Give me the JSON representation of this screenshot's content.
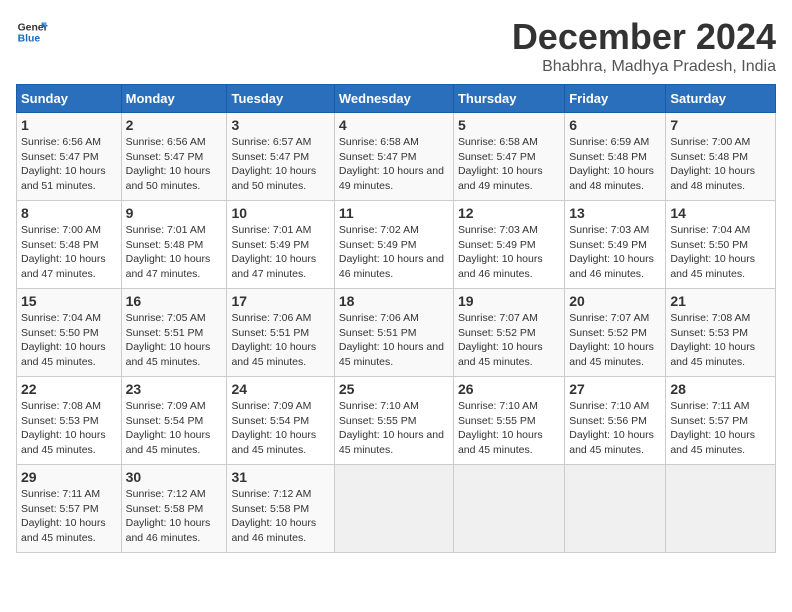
{
  "logo": {
    "line1": "General",
    "line2": "Blue"
  },
  "title": "December 2024",
  "subtitle": "Bhabhra, Madhya Pradesh, India",
  "weekdays": [
    "Sunday",
    "Monday",
    "Tuesday",
    "Wednesday",
    "Thursday",
    "Friday",
    "Saturday"
  ],
  "weeks": [
    [
      {
        "day": "1",
        "sunrise": "6:56 AM",
        "sunset": "5:47 PM",
        "daylight": "10 hours and 51 minutes."
      },
      {
        "day": "2",
        "sunrise": "6:56 AM",
        "sunset": "5:47 PM",
        "daylight": "10 hours and 50 minutes."
      },
      {
        "day": "3",
        "sunrise": "6:57 AM",
        "sunset": "5:47 PM",
        "daylight": "10 hours and 50 minutes."
      },
      {
        "day": "4",
        "sunrise": "6:58 AM",
        "sunset": "5:47 PM",
        "daylight": "10 hours and 49 minutes."
      },
      {
        "day": "5",
        "sunrise": "6:58 AM",
        "sunset": "5:47 PM",
        "daylight": "10 hours and 49 minutes."
      },
      {
        "day": "6",
        "sunrise": "6:59 AM",
        "sunset": "5:48 PM",
        "daylight": "10 hours and 48 minutes."
      },
      {
        "day": "7",
        "sunrise": "7:00 AM",
        "sunset": "5:48 PM",
        "daylight": "10 hours and 48 minutes."
      }
    ],
    [
      {
        "day": "8",
        "sunrise": "7:00 AM",
        "sunset": "5:48 PM",
        "daylight": "10 hours and 47 minutes."
      },
      {
        "day": "9",
        "sunrise": "7:01 AM",
        "sunset": "5:48 PM",
        "daylight": "10 hours and 47 minutes."
      },
      {
        "day": "10",
        "sunrise": "7:01 AM",
        "sunset": "5:49 PM",
        "daylight": "10 hours and 47 minutes."
      },
      {
        "day": "11",
        "sunrise": "7:02 AM",
        "sunset": "5:49 PM",
        "daylight": "10 hours and 46 minutes."
      },
      {
        "day": "12",
        "sunrise": "7:03 AM",
        "sunset": "5:49 PM",
        "daylight": "10 hours and 46 minutes."
      },
      {
        "day": "13",
        "sunrise": "7:03 AM",
        "sunset": "5:49 PM",
        "daylight": "10 hours and 46 minutes."
      },
      {
        "day": "14",
        "sunrise": "7:04 AM",
        "sunset": "5:50 PM",
        "daylight": "10 hours and 45 minutes."
      }
    ],
    [
      {
        "day": "15",
        "sunrise": "7:04 AM",
        "sunset": "5:50 PM",
        "daylight": "10 hours and 45 minutes."
      },
      {
        "day": "16",
        "sunrise": "7:05 AM",
        "sunset": "5:51 PM",
        "daylight": "10 hours and 45 minutes."
      },
      {
        "day": "17",
        "sunrise": "7:06 AM",
        "sunset": "5:51 PM",
        "daylight": "10 hours and 45 minutes."
      },
      {
        "day": "18",
        "sunrise": "7:06 AM",
        "sunset": "5:51 PM",
        "daylight": "10 hours and 45 minutes."
      },
      {
        "day": "19",
        "sunrise": "7:07 AM",
        "sunset": "5:52 PM",
        "daylight": "10 hours and 45 minutes."
      },
      {
        "day": "20",
        "sunrise": "7:07 AM",
        "sunset": "5:52 PM",
        "daylight": "10 hours and 45 minutes."
      },
      {
        "day": "21",
        "sunrise": "7:08 AM",
        "sunset": "5:53 PM",
        "daylight": "10 hours and 45 minutes."
      }
    ],
    [
      {
        "day": "22",
        "sunrise": "7:08 AM",
        "sunset": "5:53 PM",
        "daylight": "10 hours and 45 minutes."
      },
      {
        "day": "23",
        "sunrise": "7:09 AM",
        "sunset": "5:54 PM",
        "daylight": "10 hours and 45 minutes."
      },
      {
        "day": "24",
        "sunrise": "7:09 AM",
        "sunset": "5:54 PM",
        "daylight": "10 hours and 45 minutes."
      },
      {
        "day": "25",
        "sunrise": "7:10 AM",
        "sunset": "5:55 PM",
        "daylight": "10 hours and 45 minutes."
      },
      {
        "day": "26",
        "sunrise": "7:10 AM",
        "sunset": "5:55 PM",
        "daylight": "10 hours and 45 minutes."
      },
      {
        "day": "27",
        "sunrise": "7:10 AM",
        "sunset": "5:56 PM",
        "daylight": "10 hours and 45 minutes."
      },
      {
        "day": "28",
        "sunrise": "7:11 AM",
        "sunset": "5:57 PM",
        "daylight": "10 hours and 45 minutes."
      }
    ],
    [
      {
        "day": "29",
        "sunrise": "7:11 AM",
        "sunset": "5:57 PM",
        "daylight": "10 hours and 45 minutes."
      },
      {
        "day": "30",
        "sunrise": "7:12 AM",
        "sunset": "5:58 PM",
        "daylight": "10 hours and 46 minutes."
      },
      {
        "day": "31",
        "sunrise": "7:12 AM",
        "sunset": "5:58 PM",
        "daylight": "10 hours and 46 minutes."
      },
      null,
      null,
      null,
      null
    ]
  ]
}
